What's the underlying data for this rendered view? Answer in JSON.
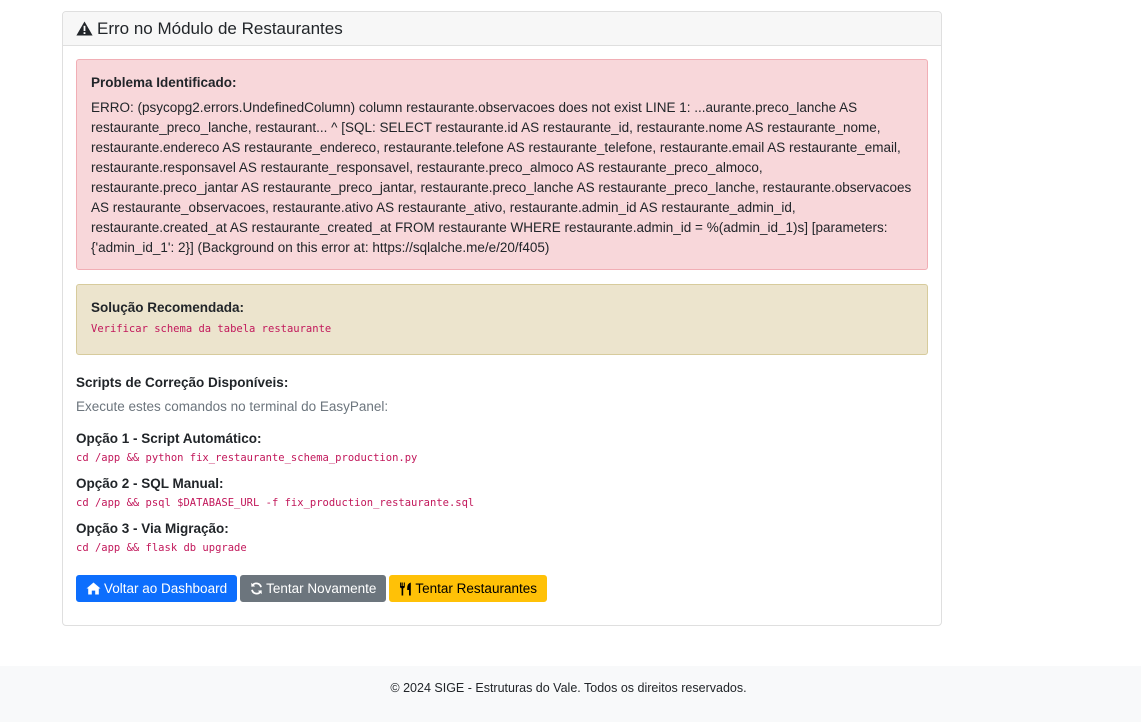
{
  "card": {
    "header_icon": "warning-triangle-icon",
    "title": "Erro no Módulo de Restaurantes"
  },
  "problem": {
    "title": "Problema Identificado:",
    "text": "ERRO: (psycopg2.errors.UndefinedColumn) column restaurante.observacoes does not exist LINE 1: ...aurante.preco_lanche AS restaurante_preco_lanche, restaurant... ^ [SQL: SELECT restaurante.id AS restaurante_id, restaurante.nome AS restaurante_nome, restaurante.endereco AS restaurante_endereco, restaurante.telefone AS restaurante_telefone, restaurante.email AS restaurante_email, restaurante.responsavel AS restaurante_responsavel, restaurante.preco_almoco AS restaurante_preco_almoco, restaurante.preco_jantar AS restaurante_preco_jantar, restaurante.preco_lanche AS restaurante_preco_lanche, restaurante.observacoes AS restaurante_observacoes, restaurante.ativo AS restaurante_ativo, restaurante.admin_id AS restaurante_admin_id, restaurante.created_at AS restaurante_created_at FROM restaurante WHERE restaurante.admin_id = %(admin_id_1)s] [parameters: {'admin_id_1': 2}] (Background on this error at: https://sqlalche.me/e/20/f405)"
  },
  "solution": {
    "title": "Solução Recomendada:",
    "code": "Verificar schema da tabela restaurante"
  },
  "scripts": {
    "title": "Scripts de Correção Disponíveis:",
    "subtitle": "Execute estes comandos no terminal do EasyPanel:",
    "options": [
      {
        "label": "Opção 1 - Script Automático:",
        "command": "cd /app && python fix_restaurante_schema_production.py"
      },
      {
        "label": "Opção 2 - SQL Manual:",
        "command": "cd /app && psql $DATABASE_URL -f fix_production_restaurante.sql"
      },
      {
        "label": "Opção 3 - Via Migração:",
        "command": "cd /app && flask db upgrade"
      }
    ]
  },
  "buttons": {
    "dashboard": {
      "label": "Voltar ao Dashboard",
      "icon": "home-icon",
      "color": "#0d6efd"
    },
    "retry": {
      "label": "Tentar Novamente",
      "icon": "refresh-icon",
      "color": "#6c757d"
    },
    "restaurants": {
      "label": "Tentar Restaurantes",
      "icon": "utensils-icon",
      "color": "#ffc107"
    }
  },
  "footer": {
    "text": "© 2024 SIGE - Estruturas do Vale. Todos os direitos reservados."
  }
}
